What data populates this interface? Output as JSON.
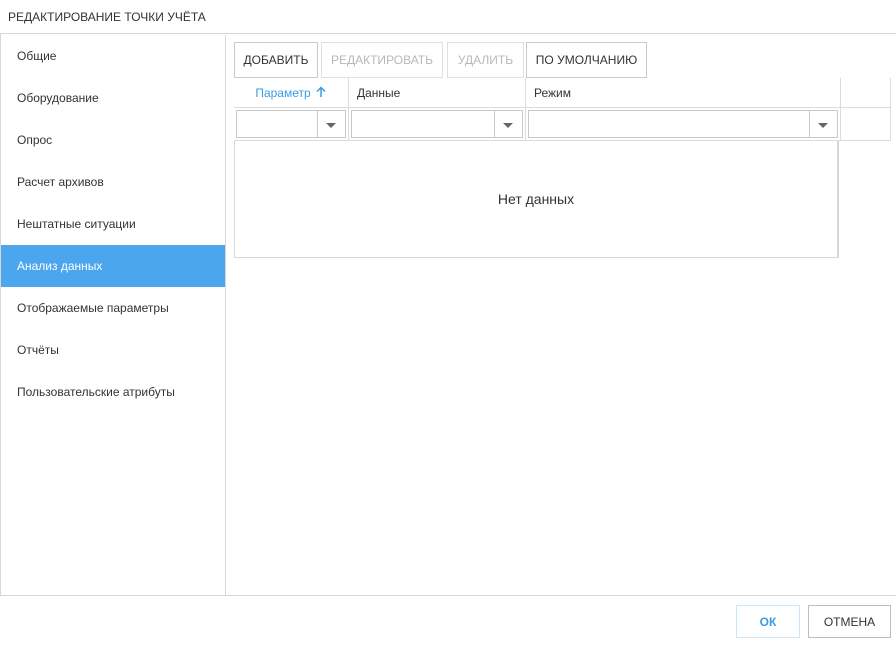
{
  "window": {
    "title": "РЕДАКТИРОВАНИЕ ТОЧКИ УЧЁТА"
  },
  "sidebar": {
    "items": [
      {
        "label": "Общие"
      },
      {
        "label": "Оборудование"
      },
      {
        "label": "Опрос"
      },
      {
        "label": "Расчет архивов"
      },
      {
        "label": "Нештатные ситуации"
      },
      {
        "label": "Анализ данных",
        "active": true
      },
      {
        "label": "Отображаемые параметры"
      },
      {
        "label": "Отчёты"
      },
      {
        "label": "Пользовательские атрибуты"
      }
    ]
  },
  "toolbar": {
    "add_label": "ДОБАВИТЬ",
    "edit_label": "РЕДАКТИРОВАТЬ",
    "delete_label": "УДАЛИТЬ",
    "default_label": "ПО УМОЛЧАНИЮ"
  },
  "grid": {
    "columns": [
      {
        "label": "Параметр",
        "sort": "ascending"
      },
      {
        "label": "Данные"
      },
      {
        "label": "Режим"
      }
    ],
    "empty_text": "Нет данных"
  },
  "footer": {
    "ok_label": "ОК",
    "cancel_label": "ОТМЕНА"
  },
  "colors": {
    "accent": "#4ba6ee",
    "sort_header": "#3a9be6",
    "border": "#d7d7d7"
  }
}
